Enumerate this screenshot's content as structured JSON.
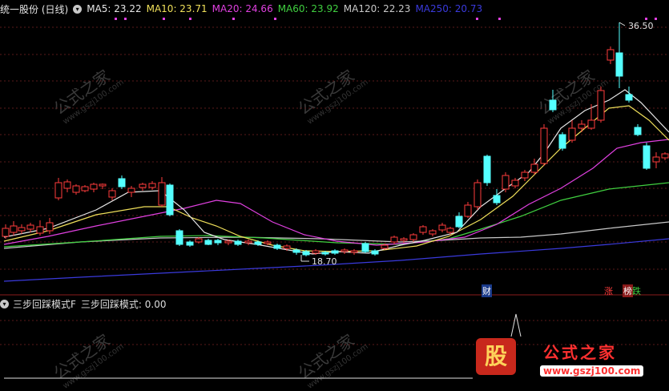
{
  "header": {
    "stock": "统一股份 (日线)",
    "toggle_icon": "chevron-down-icon",
    "indicators": [
      {
        "label": "MA5: 23.22",
        "color": "#e6e6e6"
      },
      {
        "label": "MA10: 23.71",
        "color": "#f0e05a"
      },
      {
        "label": "MA20: 24.66",
        "color": "#e040e0"
      },
      {
        "label": "MA60: 23.92",
        "color": "#40d040"
      },
      {
        "label": "MA120: 22.23",
        "color": "#c8c8c8"
      },
      {
        "label": "MA250: 20.73",
        "color": "#3a3adc"
      }
    ]
  },
  "price_panel": {
    "high_label": "36.50",
    "low_label": "18.70",
    "event_tags": [
      "财",
      "涨",
      "榜",
      "跌"
    ]
  },
  "indicator_panel": {
    "name": "三步回踩模式F",
    "value_label": "三步回踩模式: 0.00"
  },
  "watermark": {
    "text": "公式之家",
    "url": "www.gszj100.com"
  },
  "logo": {
    "char": "股",
    "title": "公式之家",
    "url": "www.gszj100.com"
  },
  "colors": {
    "up": "#ff3c3c",
    "down": "#54ffff",
    "ma5": "#e6e6e6",
    "ma10": "#f0e05a",
    "ma20": "#e040e0",
    "ma60": "#40d040",
    "ma120": "#c8c8c8",
    "ma250": "#3a3adc"
  }
}
